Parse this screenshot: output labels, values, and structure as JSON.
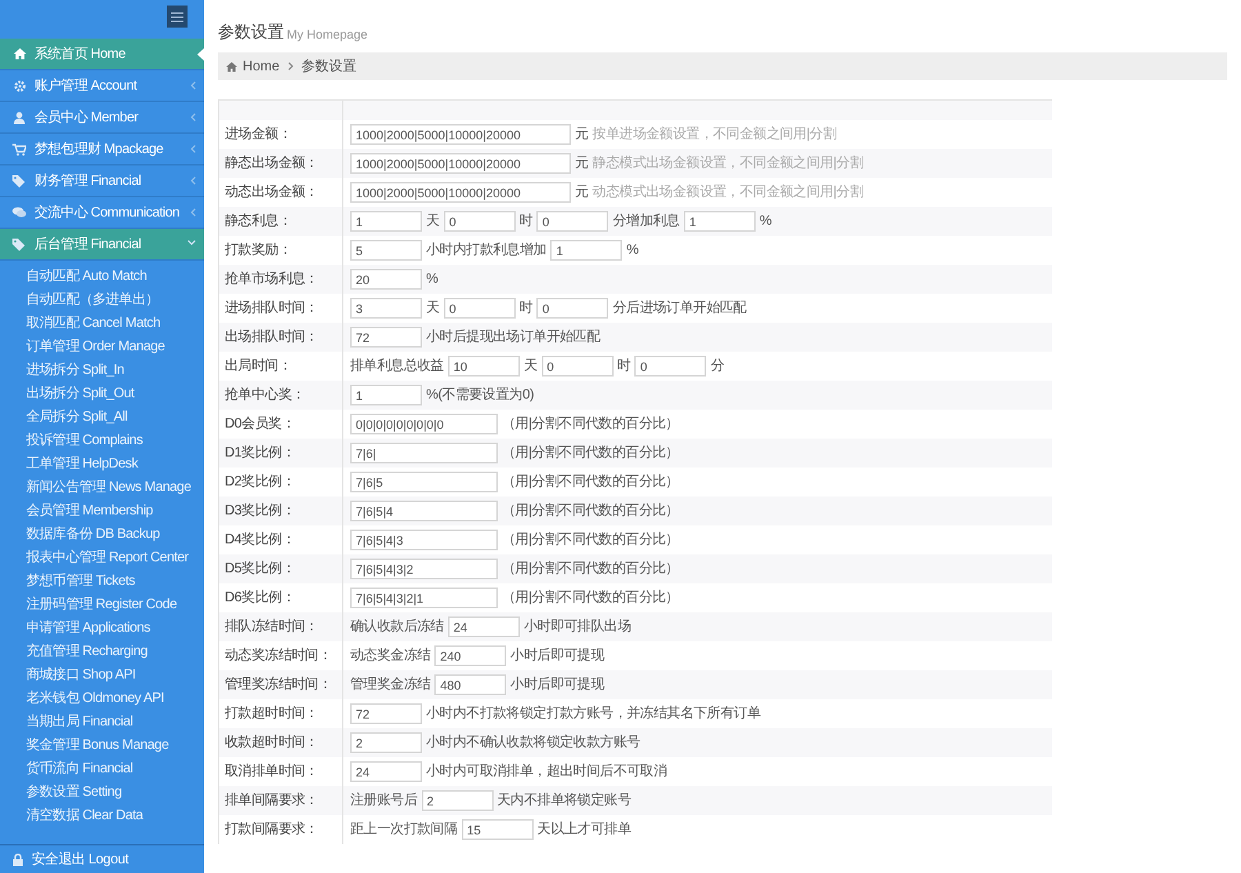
{
  "sidebar": {
    "items": [
      {
        "label": "系统首页 Home",
        "selected": true
      },
      {
        "label": "账户管理 Account",
        "selected": false,
        "expanded": false
      },
      {
        "label": "会员中心 Member",
        "selected": false,
        "expanded": false
      },
      {
        "label": "梦想包理财 Mpackage",
        "selected": false,
        "expanded": false
      },
      {
        "label": "财务管理 Financial",
        "selected": false,
        "expanded": false
      },
      {
        "label": "交流中心 Communication",
        "selected": false,
        "expanded": false
      },
      {
        "label": "后台管理 Financial",
        "selected": false,
        "expanded": true,
        "children": [
          "自动匹配 Auto Match",
          "自动匹配（多进单出）",
          "取消匹配 Cancel Match",
          "订单管理 Order Manage",
          "进场拆分 Split_In",
          "出场拆分 Split_Out",
          "全局拆分 Split_All",
          "投诉管理 Complains",
          "工单管理 HelpDesk",
          "新闻公告管理 News Manage",
          "会员管理 Membership",
          "数据库备份 DB Backup",
          "报表中心管理 Report Center",
          "梦想币管理 Tickets",
          "注册码管理 Register Code",
          "申请管理 Applications",
          "充值管理 Recharging",
          "商城接口 Shop API",
          "老米钱包 Oldmoney API",
          "当期出局 Financial",
          "奖金管理 Bonus Manage",
          "货币流向 Financial",
          "参数设置 Setting",
          "清空数据 Clear Data"
        ]
      }
    ],
    "logout": "安全退出 Logout"
  },
  "page_title": "参数设置",
  "page_subtitle": "My Homepage",
  "breadcrumb": [
    "Home",
    "参数设置"
  ],
  "form": {
    "rows": [
      {
        "label": "进场金额：",
        "parts": [
          {
            "kind": "long",
            "value": "1000|2000|5000|10000|20000"
          },
          {
            "kind": "text",
            "text": "元"
          },
          {
            "kind": "hint",
            "text": "按单进场金额设置，不同金额之间用|分割"
          }
        ]
      },
      {
        "label": "静态出场金额：",
        "parts": [
          {
            "kind": "long",
            "value": "1000|2000|5000|10000|20000"
          },
          {
            "kind": "text",
            "text": "元"
          },
          {
            "kind": "hint",
            "text": "静态模式出场金额设置，不同金额之间用|分割"
          }
        ]
      },
      {
        "label": "动态出场金额：",
        "parts": [
          {
            "kind": "long",
            "value": "1000|2000|5000|10000|20000"
          },
          {
            "kind": "text",
            "text": "元"
          },
          {
            "kind": "hint",
            "text": "动态模式出场金额设置，不同金额之间用|分割"
          }
        ]
      },
      {
        "label": "静态利息：",
        "parts": [
          {
            "kind": "short",
            "value": "1"
          },
          {
            "kind": "text",
            "text": "天"
          },
          {
            "kind": "short",
            "value": "0"
          },
          {
            "kind": "text",
            "text": "时"
          },
          {
            "kind": "short",
            "value": "0"
          },
          {
            "kind": "text",
            "text": "分增加利息"
          },
          {
            "kind": "short",
            "value": "1"
          },
          {
            "kind": "text",
            "text": "%"
          }
        ]
      },
      {
        "label": "打款奖励：",
        "parts": [
          {
            "kind": "short",
            "value": "5"
          },
          {
            "kind": "text",
            "text": "小时内打款利息增加"
          },
          {
            "kind": "short",
            "value": "1"
          },
          {
            "kind": "text",
            "text": "%"
          }
        ]
      },
      {
        "label": "抢单市场利息：",
        "parts": [
          {
            "kind": "short",
            "value": "20"
          },
          {
            "kind": "text",
            "text": "%"
          }
        ]
      },
      {
        "label": "进场排队时间：",
        "parts": [
          {
            "kind": "short",
            "value": "3"
          },
          {
            "kind": "text",
            "text": "天"
          },
          {
            "kind": "short",
            "value": "0"
          },
          {
            "kind": "text",
            "text": "时"
          },
          {
            "kind": "short",
            "value": "0"
          },
          {
            "kind": "text",
            "text": "分后进场订单开始匹配"
          }
        ]
      },
      {
        "label": "出场排队时间：",
        "parts": [
          {
            "kind": "short",
            "value": "72"
          },
          {
            "kind": "text",
            "text": "小时后提现出场订单开始匹配"
          }
        ]
      },
      {
        "label": "出局时间：",
        "parts": [
          {
            "kind": "text",
            "text": "排单利息总收益"
          },
          {
            "kind": "short",
            "value": "10"
          },
          {
            "kind": "text",
            "text": "天"
          },
          {
            "kind": "short",
            "value": "0"
          },
          {
            "kind": "text",
            "text": "时"
          },
          {
            "kind": "short",
            "value": "0"
          },
          {
            "kind": "text",
            "text": "分"
          }
        ]
      },
      {
        "label": "抢单中心奖：",
        "parts": [
          {
            "kind": "short",
            "value": "1"
          },
          {
            "kind": "text",
            "text": "%(不需要设置为0)"
          }
        ]
      },
      {
        "label": "D0会员奖：",
        "parts": [
          {
            "kind": "mid",
            "value": "0|0|0|0|0|0|0|0|0"
          },
          {
            "kind": "text",
            "text": "（用|分割不同代数的百分比）"
          }
        ]
      },
      {
        "label": "D1奖比例：",
        "parts": [
          {
            "kind": "mid",
            "value": "7|6|"
          },
          {
            "kind": "text",
            "text": "（用|分割不同代数的百分比）"
          }
        ]
      },
      {
        "label": "D2奖比例：",
        "parts": [
          {
            "kind": "mid",
            "value": "7|6|5"
          },
          {
            "kind": "text",
            "text": "（用|分割不同代数的百分比）"
          }
        ]
      },
      {
        "label": "D3奖比例：",
        "parts": [
          {
            "kind": "mid",
            "value": "7|6|5|4"
          },
          {
            "kind": "text",
            "text": "（用|分割不同代数的百分比）"
          }
        ]
      },
      {
        "label": "D4奖比例：",
        "parts": [
          {
            "kind": "mid",
            "value": "7|6|5|4|3"
          },
          {
            "kind": "text",
            "text": "（用|分割不同代数的百分比）"
          }
        ]
      },
      {
        "label": "D5奖比例：",
        "parts": [
          {
            "kind": "mid",
            "value": "7|6|5|4|3|2"
          },
          {
            "kind": "text",
            "text": "（用|分割不同代数的百分比）"
          }
        ]
      },
      {
        "label": "D6奖比例：",
        "parts": [
          {
            "kind": "mid",
            "value": "7|6|5|4|3|2|1"
          },
          {
            "kind": "text",
            "text": "（用|分割不同代数的百分比）"
          }
        ]
      },
      {
        "label": "排队冻结时间：",
        "parts": [
          {
            "kind": "text",
            "text": "确认收款后冻结"
          },
          {
            "kind": "short",
            "value": "24"
          },
          {
            "kind": "text",
            "text": "小时即可排队出场"
          }
        ]
      },
      {
        "label": "动态奖冻结时间：",
        "parts": [
          {
            "kind": "text",
            "text": "动态奖金冻结"
          },
          {
            "kind": "short",
            "value": "240"
          },
          {
            "kind": "text",
            "text": "小时后即可提现"
          }
        ]
      },
      {
        "label": "管理奖冻结时间：",
        "parts": [
          {
            "kind": "text",
            "text": "管理奖金冻结"
          },
          {
            "kind": "short",
            "value": "480"
          },
          {
            "kind": "text",
            "text": "小时后即可提现"
          }
        ]
      },
      {
        "label": "打款超时时间：",
        "parts": [
          {
            "kind": "short",
            "value": "72"
          },
          {
            "kind": "text",
            "text": "小时内不打款将锁定打款方账号，并冻结其名下所有订单"
          }
        ]
      },
      {
        "label": "收款超时时间：",
        "parts": [
          {
            "kind": "short",
            "value": "2"
          },
          {
            "kind": "text",
            "text": "小时内不确认收款将锁定收款方账号"
          }
        ]
      },
      {
        "label": "取消排单时间：",
        "parts": [
          {
            "kind": "short",
            "value": "24"
          },
          {
            "kind": "text",
            "text": "小时内可取消排单，超出时间后不可取消"
          }
        ]
      },
      {
        "label": "排单间隔要求：",
        "parts": [
          {
            "kind": "text",
            "text": "注册账号后"
          },
          {
            "kind": "short",
            "value": "2"
          },
          {
            "kind": "text",
            "text": "天内不排单将锁定账号"
          }
        ]
      },
      {
        "label": "打款间隔要求：",
        "parts": [
          {
            "kind": "text",
            "text": "距上一次打款间隔"
          },
          {
            "kind": "short",
            "value": "15"
          },
          {
            "kind": "text",
            "text": "天以上才可排单"
          }
        ]
      }
    ]
  }
}
